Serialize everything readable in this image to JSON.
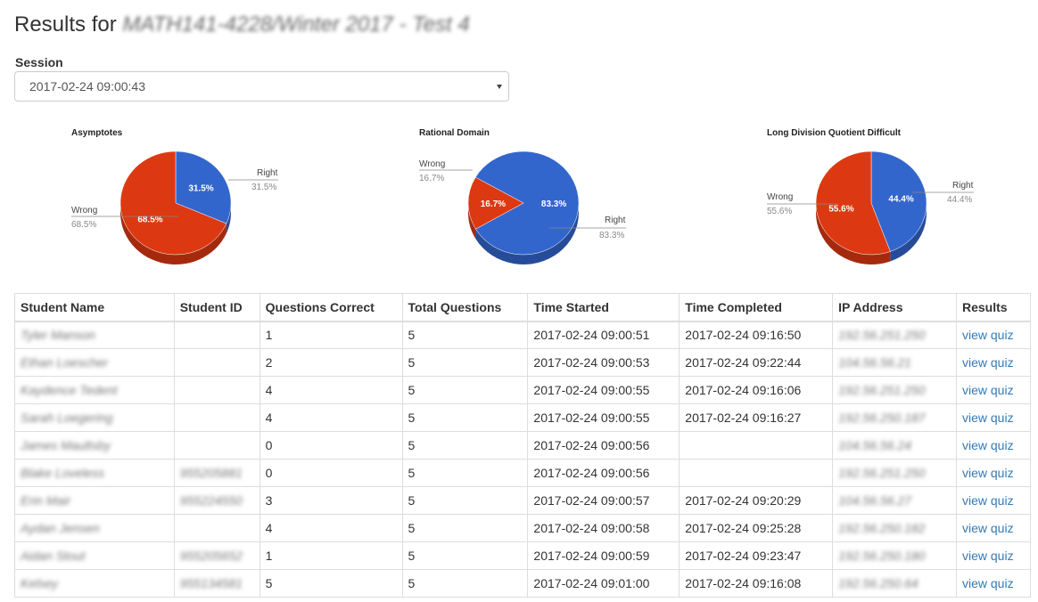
{
  "header": {
    "title_prefix": "Results for",
    "title_course": "MATH141-4228/Winter 2017 - Test 4"
  },
  "session": {
    "label": "Session",
    "selected": "2017-02-24 09:00:43"
  },
  "colors": {
    "right": "#3366cc",
    "wrong": "#dc3912",
    "right_dark": "#264c99",
    "wrong_dark": "#a52a0d"
  },
  "charts": [
    {
      "title": "Asymptotes",
      "slices": [
        {
          "name": "Right",
          "value": 31.5,
          "label": "31.5%"
        },
        {
          "name": "Wrong",
          "value": 68.5,
          "label": "68.5%"
        }
      ]
    },
    {
      "title": "Rational Domain",
      "slices": [
        {
          "name": "Right",
          "value": 83.3,
          "label": "83.3%"
        },
        {
          "name": "Wrong",
          "value": 16.7,
          "label": "16.7%"
        }
      ]
    },
    {
      "title": "Long Division Quotient Difficult",
      "slices": [
        {
          "name": "Right",
          "value": 44.4,
          "label": "44.4%"
        },
        {
          "name": "Wrong",
          "value": 55.6,
          "label": "55.6%"
        }
      ]
    }
  ],
  "table": {
    "headers": [
      "Student Name",
      "Student ID",
      "Questions Correct",
      "Total Questions",
      "Time Started",
      "Time Completed",
      "IP Address",
      "Results"
    ],
    "rows": [
      {
        "name": "Tyler Manson",
        "id": "",
        "correct": "1",
        "total": "5",
        "started": "2017-02-24 09:00:51",
        "completed": "2017-02-24 09:16:50",
        "ip": "192.56.251.250",
        "link": "view quiz"
      },
      {
        "name": "Ethan Loescher",
        "id": "",
        "correct": "2",
        "total": "5",
        "started": "2017-02-24 09:00:53",
        "completed": "2017-02-24 09:22:44",
        "ip": "104.56.56.21",
        "link": "view quiz"
      },
      {
        "name": "Kaydence Tedent",
        "id": "",
        "correct": "4",
        "total": "5",
        "started": "2017-02-24 09:00:55",
        "completed": "2017-02-24 09:16:06",
        "ip": "192.56.251.250",
        "link": "view quiz"
      },
      {
        "name": "Sarah Loegering",
        "id": "",
        "correct": "4",
        "total": "5",
        "started": "2017-02-24 09:00:55",
        "completed": "2017-02-24 09:16:27",
        "ip": "192.56.250.187",
        "link": "view quiz"
      },
      {
        "name": "James Maultsby",
        "id": "",
        "correct": "0",
        "total": "5",
        "started": "2017-02-24 09:00:56",
        "completed": "",
        "ip": "104.56.56.24",
        "link": "view quiz"
      },
      {
        "name": "Blake Loveless",
        "id": "955205881",
        "correct": "0",
        "total": "5",
        "started": "2017-02-24 09:00:56",
        "completed": "",
        "ip": "192.56.251.250",
        "link": "view quiz"
      },
      {
        "name": "Erin Mair",
        "id": "955224550",
        "correct": "3",
        "total": "5",
        "started": "2017-02-24 09:00:57",
        "completed": "2017-02-24 09:20:29",
        "ip": "104.56.56.27",
        "link": "view quiz"
      },
      {
        "name": "Aydan Jensen",
        "id": "",
        "correct": "4",
        "total": "5",
        "started": "2017-02-24 09:00:58",
        "completed": "2017-02-24 09:25:28",
        "ip": "192.56.250.182",
        "link": "view quiz"
      },
      {
        "name": "Aidan Stout",
        "id": "955205652",
        "correct": "1",
        "total": "5",
        "started": "2017-02-24 09:00:59",
        "completed": "2017-02-24 09:23:47",
        "ip": "192.56.250.180",
        "link": "view quiz"
      },
      {
        "name": "Kelsey",
        "id": "955134581",
        "correct": "5",
        "total": "5",
        "started": "2017-02-24 09:01:00",
        "completed": "2017-02-24 09:16:08",
        "ip": "192.56.250.64",
        "link": "view quiz"
      }
    ]
  }
}
